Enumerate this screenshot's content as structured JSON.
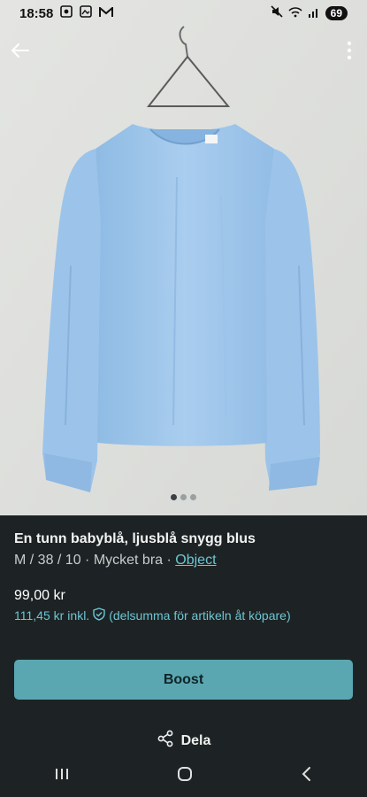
{
  "status_bar": {
    "time": "18:58",
    "battery": "69",
    "icons": [
      "screenshot-icon",
      "gallery-icon",
      "gmail-icon",
      "mute-icon",
      "wifi-icon",
      "signal-icon",
      "battery-icon"
    ]
  },
  "toolbar": {
    "back_icon": "arrow-left-icon",
    "more_icon": "more-vertical-icon"
  },
  "carousel": {
    "image_description": "Light blue long-sleeve blouse on a hanger",
    "page_count": 3,
    "active_page": 1
  },
  "listing": {
    "title": "En tunn babyblå, ljusblå snygg blus",
    "size_condition": "M / 38 / 10 · Mycket bra ·",
    "brand": "Object",
    "price": "99,00 kr",
    "buyer_price": "111,45 kr",
    "buyer_price_suffix": "inkl.",
    "buyer_note": "(delsumma för artikeln åt köpare)"
  },
  "actions": {
    "boost_label": "Boost",
    "share_label": "Dela"
  },
  "colors": {
    "background": "#1d2324",
    "accent": "#5aa7b2",
    "link": "#6cc6d3",
    "blouse": "#a9cdec"
  }
}
